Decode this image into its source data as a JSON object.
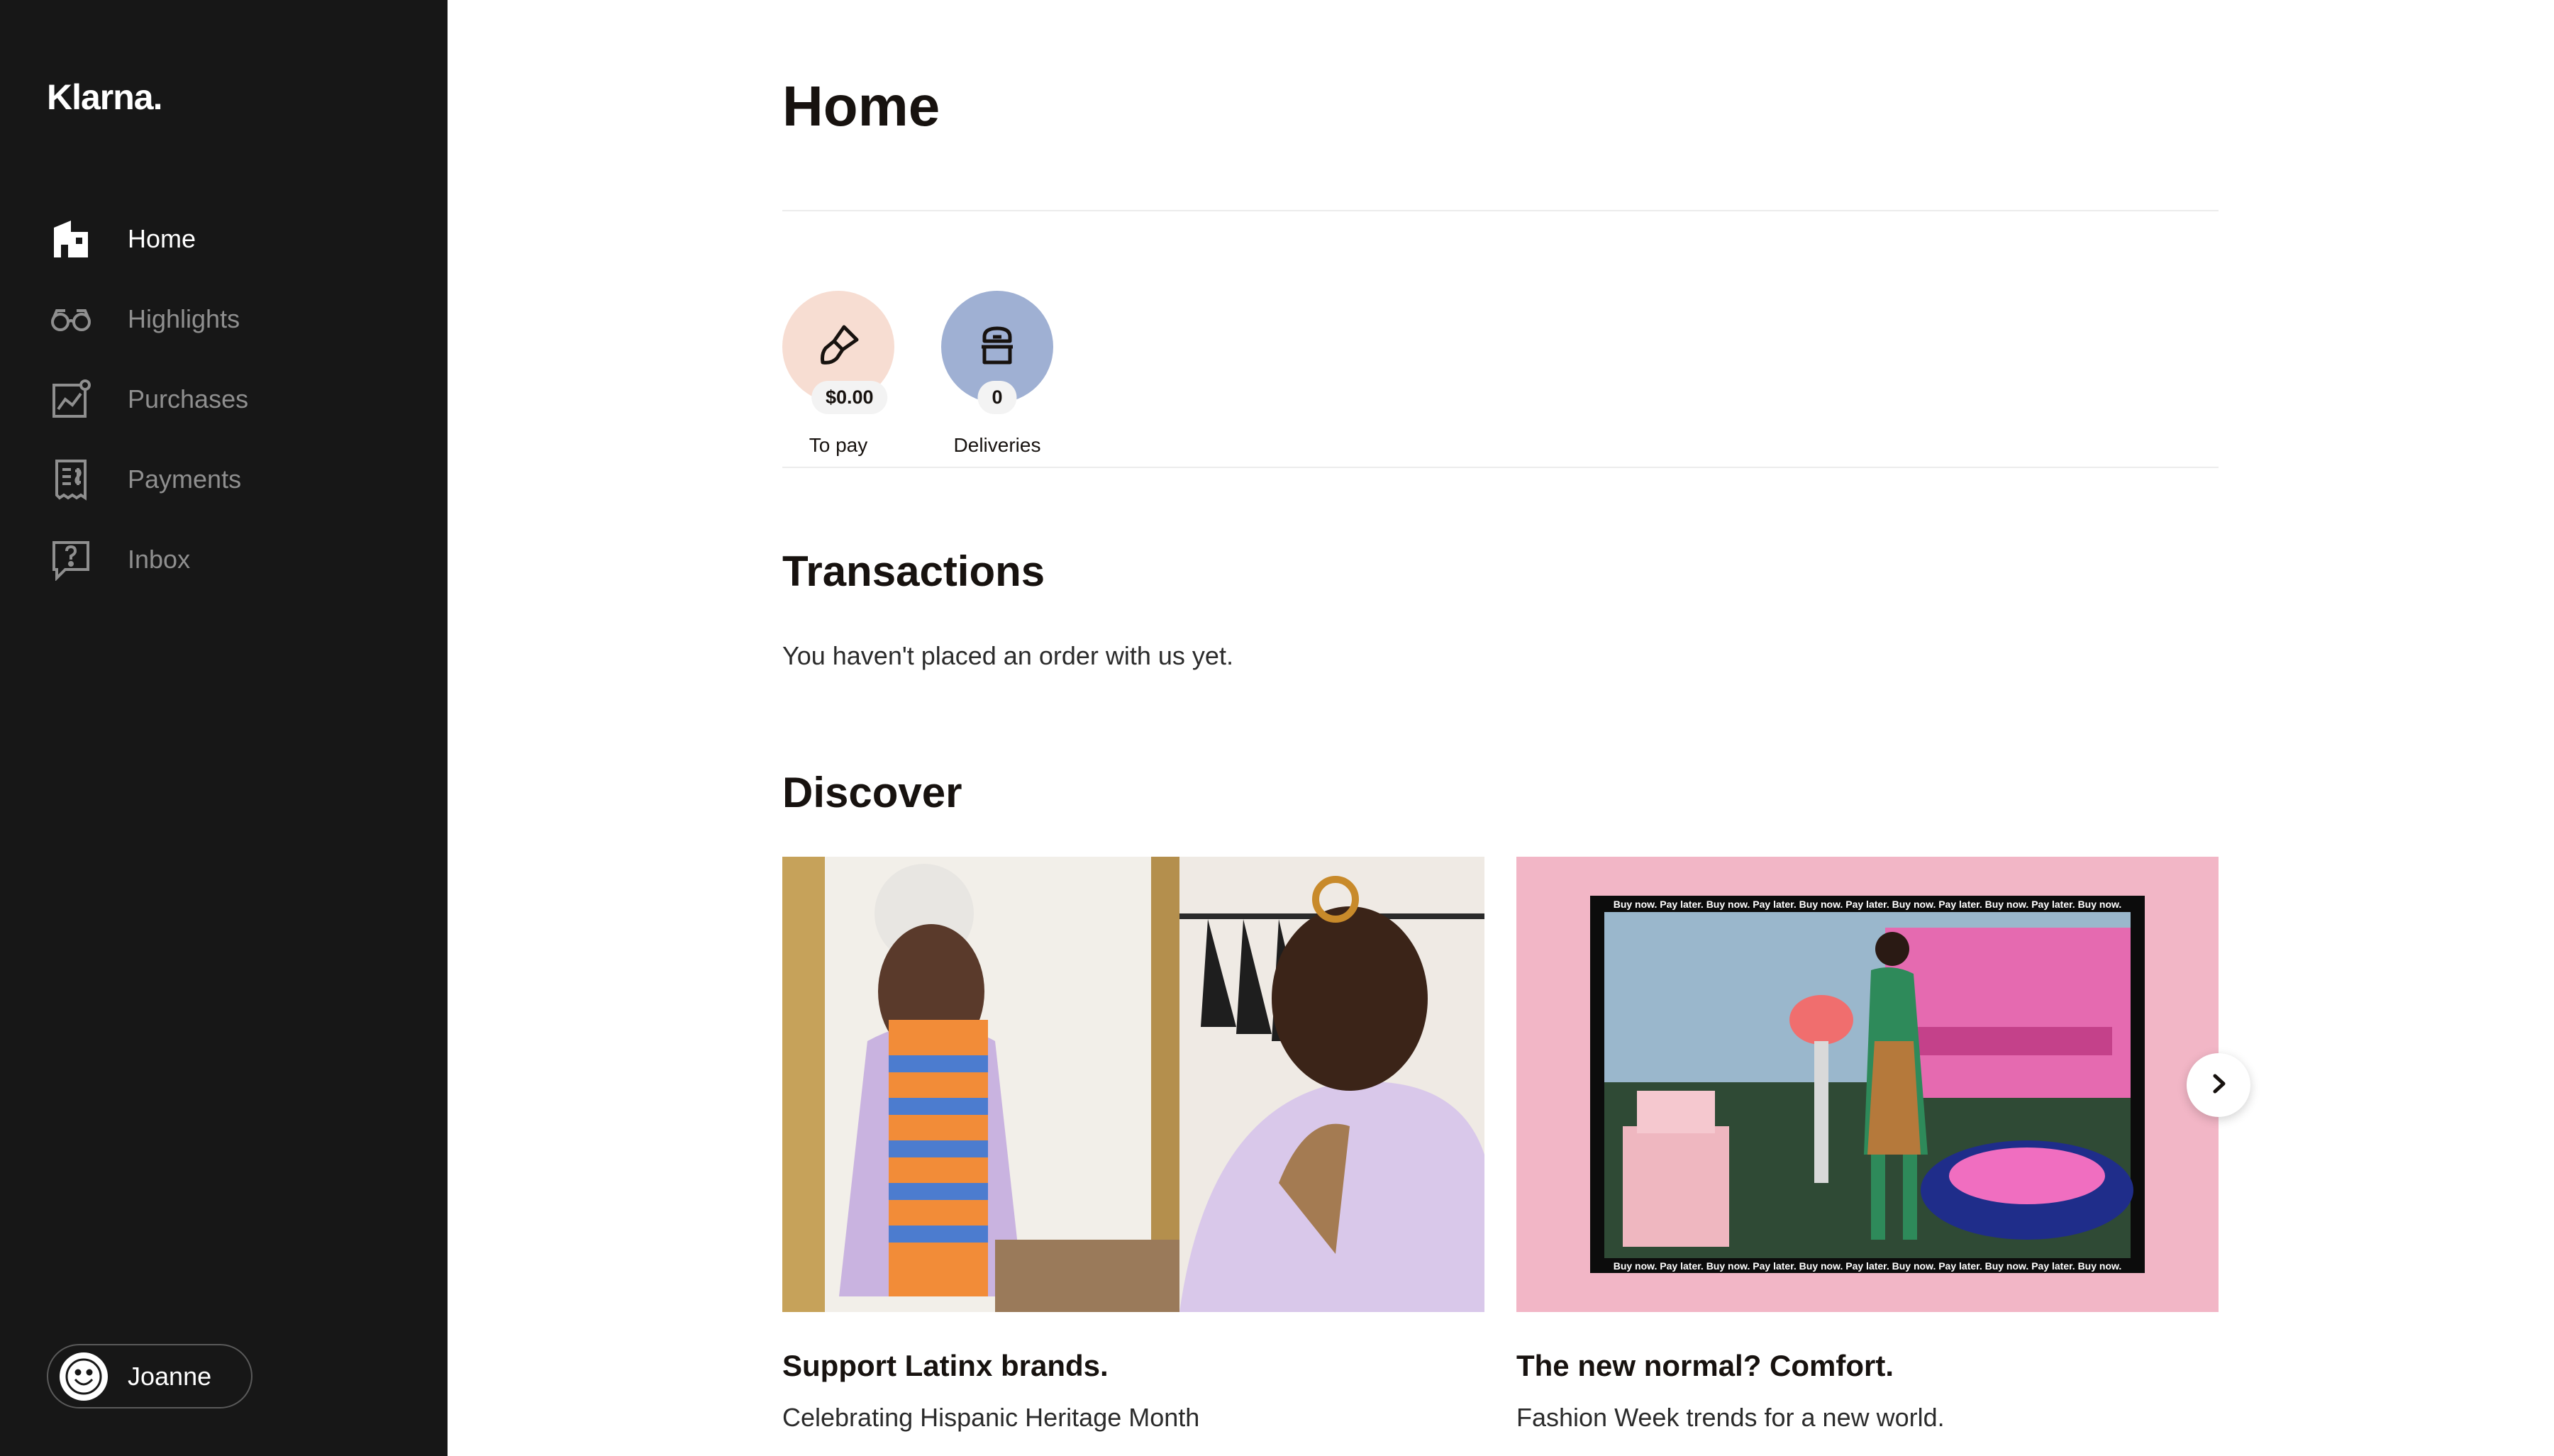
{
  "brand": {
    "logo_text": "Klarna."
  },
  "sidebar": {
    "items": [
      {
        "label": "Home",
        "icon": "home-icon",
        "active": true
      },
      {
        "label": "Highlights",
        "icon": "glasses-icon",
        "active": false
      },
      {
        "label": "Purchases",
        "icon": "chart-icon",
        "active": false
      },
      {
        "label": "Payments",
        "icon": "receipt-icon",
        "active": false
      },
      {
        "label": "Inbox",
        "icon": "help-chat-icon",
        "active": false
      }
    ],
    "user": {
      "name": "Joanne",
      "icon": "smiley-avatar-icon"
    }
  },
  "main": {
    "title": "Home",
    "summary": [
      {
        "label": "To pay",
        "badge": "$0.00",
        "icon": "paintbrush-icon",
        "color": "#f7ddd2"
      },
      {
        "label": "Deliveries",
        "badge": "0",
        "icon": "parcel-icon",
        "color": "#9fb0d3"
      }
    ],
    "transactions": {
      "title": "Transactions",
      "empty_text": "You haven't placed an order with us yet."
    },
    "discover": {
      "title": "Discover",
      "cards": [
        {
          "title": "Support Latinx brands.",
          "subtitle": "Celebrating Hispanic Heritage Month"
        },
        {
          "title": "The new normal? Comfort.",
          "subtitle": "Fashion Week trends for a new world.",
          "frame_text": "Buy now. Pay later. Buy now. Pay later. Buy now. Pay later. Buy now. Pay later. Buy now. Pay later. Buy now."
        }
      ],
      "next_label": "›"
    }
  }
}
